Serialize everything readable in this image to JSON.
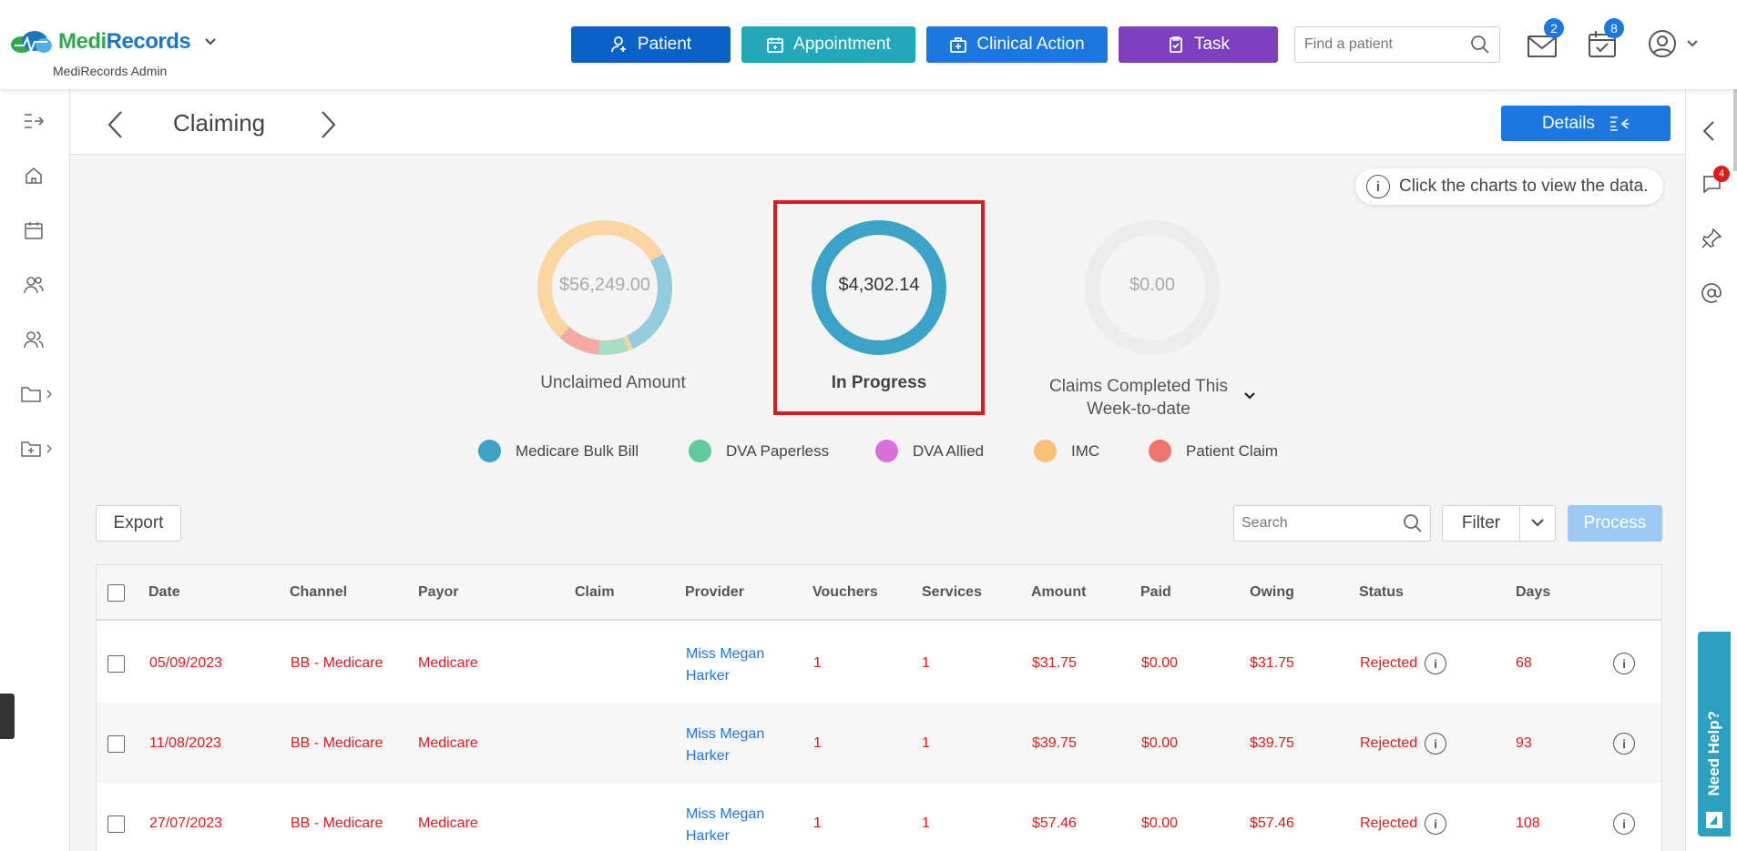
{
  "app": {
    "logo_text_a": "Medi",
    "logo_text_b": "Records",
    "subtitle": "MediRecords Admin"
  },
  "topnav": {
    "patient": "Patient",
    "appointment": "Appointment",
    "clinical_action": "Clinical Action",
    "task": "Task",
    "search_placeholder": "Find a patient",
    "mail_count": "2",
    "calendar_count": "8",
    "colors": {
      "patient": "#0a62c9",
      "appointment": "#22a8b8",
      "clinical": "#1a78e0",
      "task": "#7b3fbf"
    }
  },
  "header": {
    "title": "Claiming",
    "details_label": "Details"
  },
  "hint": "Click the charts to view the data.",
  "right_sidebar": {
    "comments_count": "4",
    "help_label": "Need Help?"
  },
  "charts": {
    "unclaimed": {
      "amount": "$56,249.00",
      "label": "Unclaimed Amount"
    },
    "in_progress": {
      "amount": "$4,302.14",
      "label": "In Progress"
    },
    "completed": {
      "amount": "$0.00",
      "label_line1": "Claims Completed This",
      "label_line2": "Week-to-date"
    }
  },
  "legend": [
    {
      "label": "Medicare Bulk Bill",
      "color": "#3aa3c6"
    },
    {
      "label": "DVA Paperless",
      "color": "#5ecb9a"
    },
    {
      "label": "DVA Allied",
      "color": "#d96fd9"
    },
    {
      "label": "IMC",
      "color": "#f9c07a"
    },
    {
      "label": "Patient Claim",
      "color": "#f0756c"
    }
  ],
  "toolbar": {
    "export": "Export",
    "search_placeholder": "Search",
    "filter": "Filter",
    "process": "Process"
  },
  "table": {
    "columns": [
      "Date",
      "Channel",
      "Payor",
      "Claim",
      "Provider",
      "Vouchers",
      "Services",
      "Amount",
      "Paid",
      "Owing",
      "Status",
      "Days"
    ],
    "rows": [
      {
        "date": "05/09/2023",
        "channel": "BB - Medicare",
        "payor": "Medicare",
        "claim": "",
        "provider1": "Miss Megan",
        "provider2": "Harker",
        "vouchers": "1",
        "services": "1",
        "amount": "$31.75",
        "paid": "$0.00",
        "owing": "$31.75",
        "status": "Rejected",
        "days": "68"
      },
      {
        "date": "11/08/2023",
        "channel": "BB - Medicare",
        "payor": "Medicare",
        "claim": "",
        "provider1": "Miss Megan",
        "provider2": "Harker",
        "vouchers": "1",
        "services": "1",
        "amount": "$39.75",
        "paid": "$0.00",
        "owing": "$39.75",
        "status": "Rejected",
        "days": "93"
      },
      {
        "date": "27/07/2023",
        "channel": "BB - Medicare",
        "payor": "Medicare",
        "claim": "",
        "provider1": "Miss Megan",
        "provider2": "Harker",
        "vouchers": "1",
        "services": "1",
        "amount": "$57.46",
        "paid": "$0.00",
        "owing": "$57.46",
        "status": "Rejected",
        "days": "108"
      }
    ]
  }
}
